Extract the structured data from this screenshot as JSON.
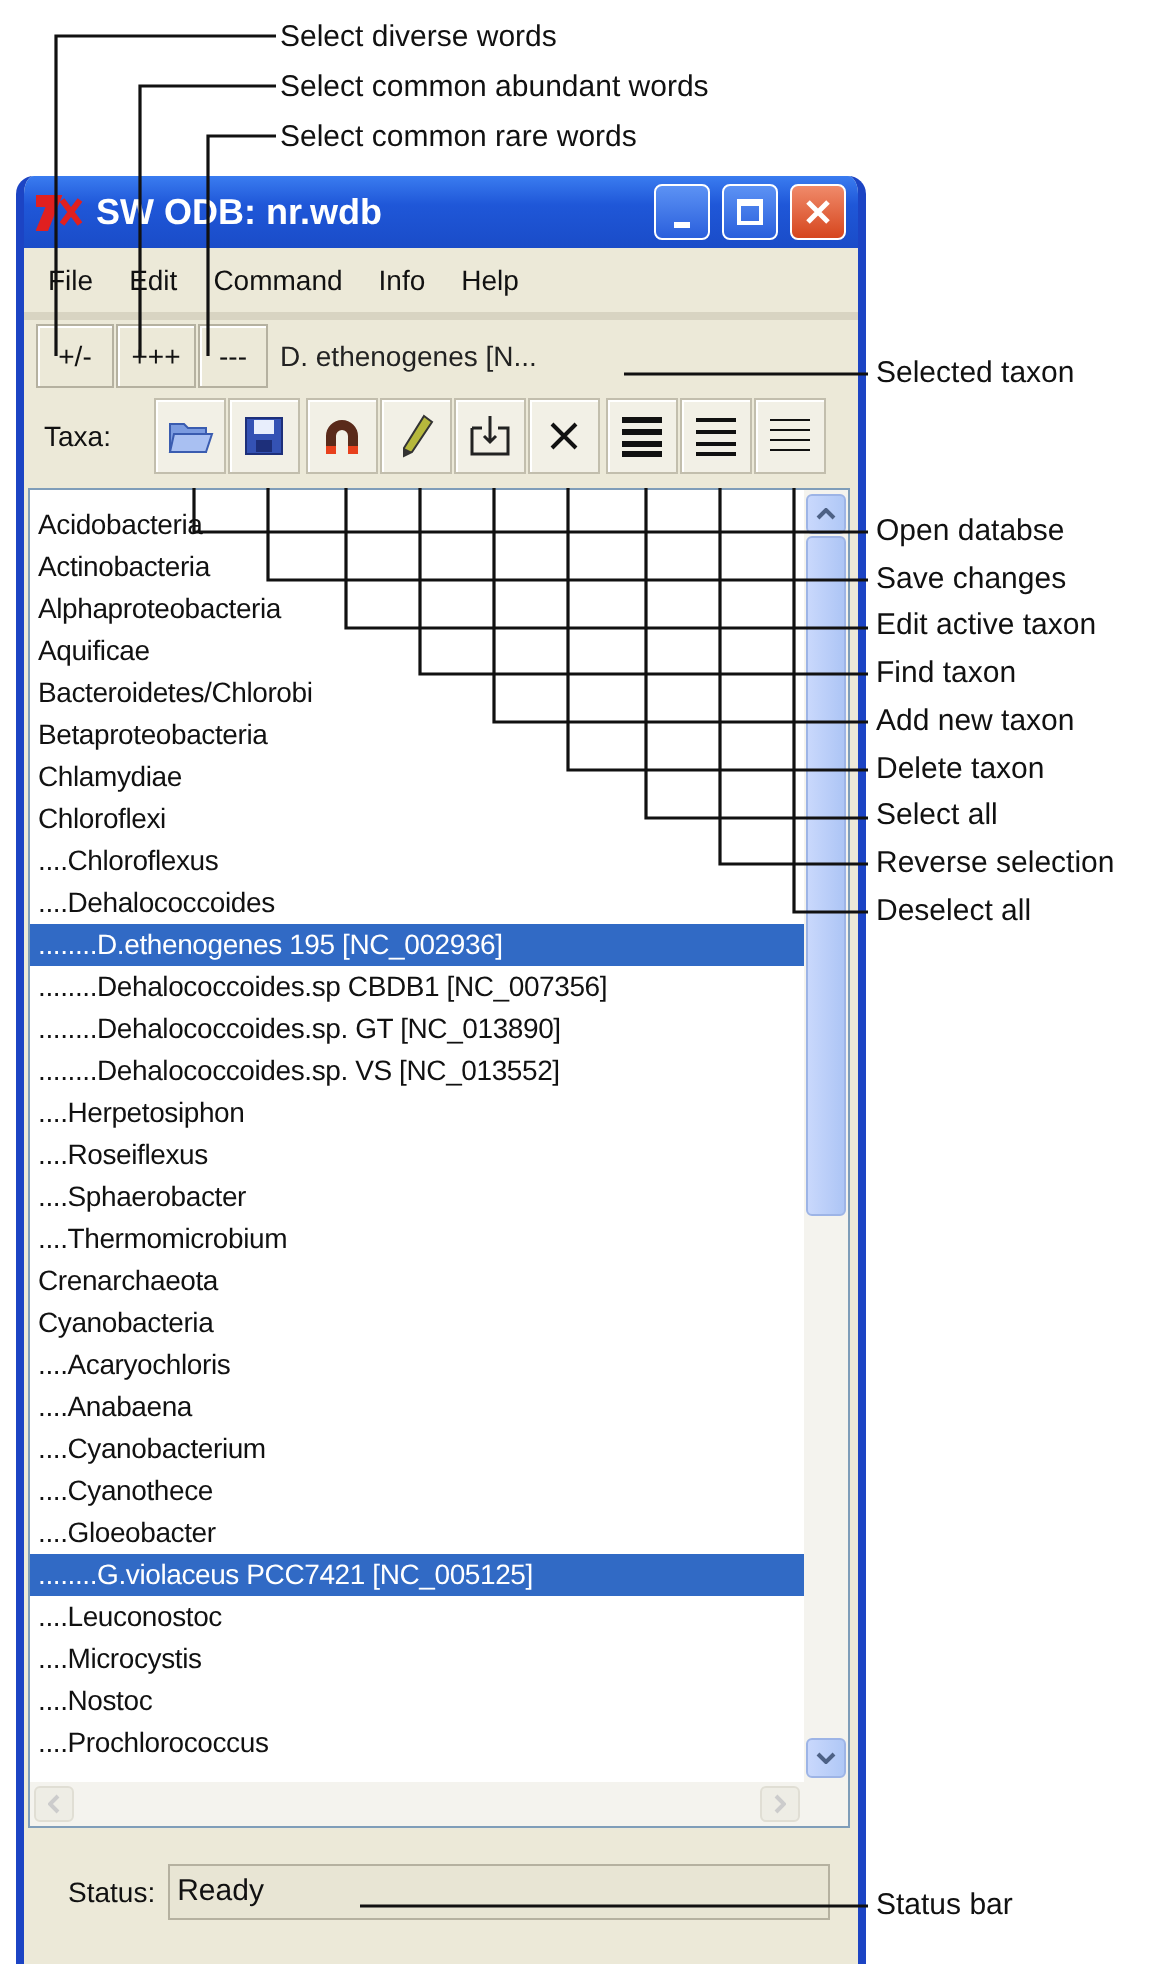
{
  "callouts_top": [
    "Select diverse words",
    "Select common abundant words",
    "Select common rare words"
  ],
  "window": {
    "title": "SW ODB: nr.wdb"
  },
  "menu": [
    "File",
    "Edit",
    "Command",
    "Info",
    "Help"
  ],
  "word_buttons": [
    "+/-",
    "+++",
    "---"
  ],
  "selected_taxon": "D. ethenogenes [N...",
  "taxa_label": "Taxa:",
  "tree": [
    {
      "label": "Acidobacteria",
      "selected": false
    },
    {
      "label": "Actinobacteria",
      "selected": false
    },
    {
      "label": "Alphaproteobacteria",
      "selected": false
    },
    {
      "label": "Aquificae",
      "selected": false
    },
    {
      "label": "Bacteroidetes/Chlorobi",
      "selected": false
    },
    {
      "label": "Betaproteobacteria",
      "selected": false
    },
    {
      "label": "Chlamydiae",
      "selected": false
    },
    {
      "label": "Chloroflexi",
      "selected": false,
      "children": [
        {
          "label": "....Chloroflexus",
          "selected": false
        },
        {
          "label": "....Dehalococcoides",
          "selected": false,
          "children": [
            {
              "label": "........D.ethenogenes 195 [NC_002936]",
              "selected": true
            },
            {
              "label": "........Dehalococcoides.sp CBDB1 [NC_007356]",
              "selected": false
            },
            {
              "label": "........Dehalococcoides.sp. GT [NC_013890]",
              "selected": false
            },
            {
              "label": "........Dehalococcoides.sp. VS [NC_013552]",
              "selected": false
            }
          ]
        },
        {
          "label": "....Herpetosiphon",
          "selected": false
        },
        {
          "label": "....Roseiflexus",
          "selected": false
        },
        {
          "label": "....Sphaerobacter",
          "selected": false
        },
        {
          "label": "....Thermomicrobium",
          "selected": false
        }
      ]
    },
    {
      "label": "Crenarchaeota",
      "selected": false
    },
    {
      "label": "Cyanobacteria",
      "selected": false,
      "children": [
        {
          "label": "....Acaryochloris",
          "selected": false
        },
        {
          "label": "....Anabaena",
          "selected": false
        },
        {
          "label": "....Cyanobacterium",
          "selected": false
        },
        {
          "label": "....Cyanothece",
          "selected": false
        },
        {
          "label": "....Gloeobacter",
          "selected": false,
          "children": [
            {
              "label": "........G.violaceus PCC7421 [NC_005125]",
              "selected": true
            }
          ]
        },
        {
          "label": "....Leuconostoc",
          "selected": false
        },
        {
          "label": "....Microcystis",
          "selected": false
        },
        {
          "label": "....Nostoc",
          "selected": false
        },
        {
          "label": "....Prochlorococcus",
          "selected": false
        }
      ]
    }
  ],
  "status": {
    "label": "Status:",
    "value": "Ready"
  },
  "callouts_right": [
    "Open databse",
    "Save changes",
    "Edit active taxon",
    "Find taxon",
    "Add new taxon",
    "Delete taxon",
    "Select all",
    "Reverse selection",
    "Deselect all"
  ],
  "callout_selected_taxon": "Selected taxon",
  "callout_status": "Status bar"
}
